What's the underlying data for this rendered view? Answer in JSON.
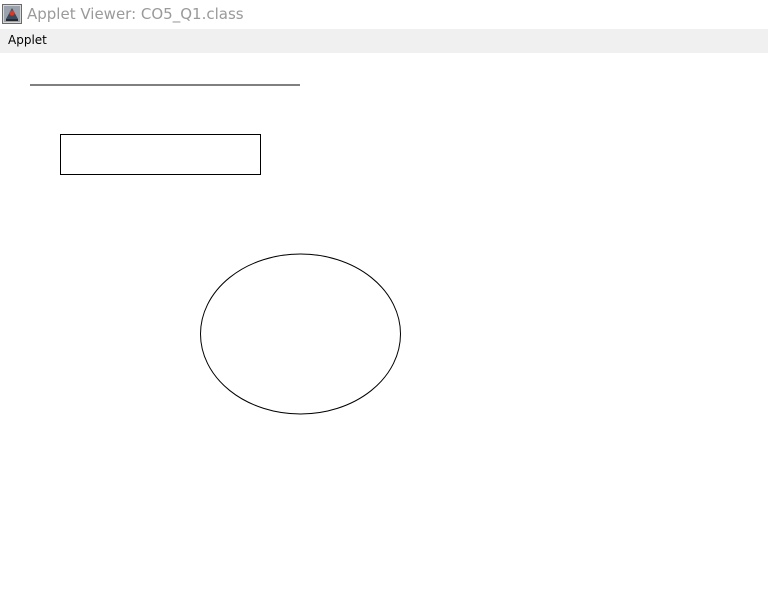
{
  "window": {
    "title": "Applet Viewer: CO5_Q1.class",
    "icon": "java-duke-icon"
  },
  "menubar": {
    "items": [
      {
        "label": "Applet"
      }
    ]
  },
  "canvas": {
    "background": "#ffffff",
    "stroke_color": "#000000",
    "shapes": [
      "line",
      "rectangle",
      "oval"
    ]
  }
}
